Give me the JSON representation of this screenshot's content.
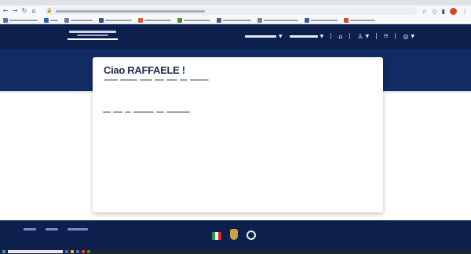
{
  "greeting": "Ciao RAFFAELE !",
  "colors": {
    "header_bg": "#0d1f4c",
    "band_bg": "#132b63",
    "footer_bg": "#0d1f4c",
    "title_text": "#1b2a4e",
    "footer_link": "#6f8cd4"
  },
  "icons": {
    "back": "arrow-left-icon",
    "forward": "arrow-right-icon",
    "reload": "reload-icon",
    "home": "home-icon",
    "lock": "lock-icon",
    "star": "star-icon",
    "extensions": "puzzle-icon",
    "user": "user-icon",
    "nav_home": "home-icon",
    "notifications": "bell-icon",
    "language": "globe-icon"
  }
}
